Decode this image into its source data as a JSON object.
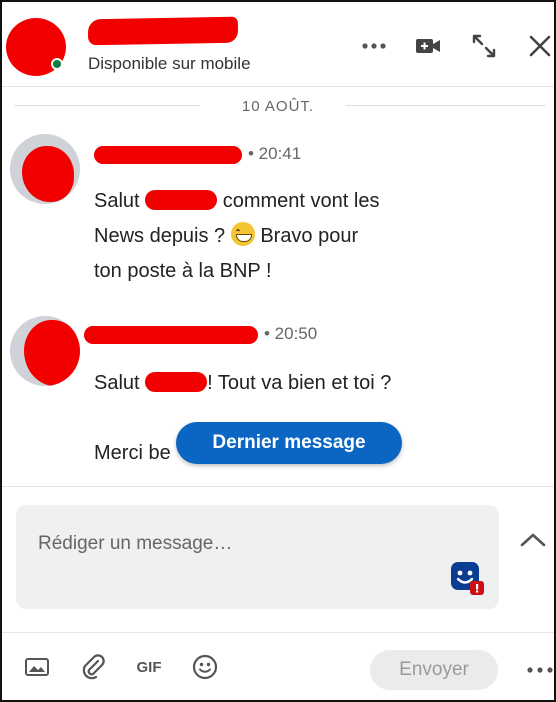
{
  "header": {
    "status": "Disponible sur mobile",
    "icons": [
      "more-icon",
      "video-call-icon",
      "minimize-icon",
      "close-icon"
    ]
  },
  "conversation": {
    "date_separator": "10 AOÛT.",
    "messages": [
      {
        "time": "• 20:41",
        "line1_before": "Salut",
        "line1_after": "comment vont les",
        "line2_before": "News depuis ?",
        "line2_after": "Bravo pour",
        "line3": "ton poste à la BNP !"
      },
      {
        "time": "• 20:50",
        "line1_before": "Salut",
        "line1_after": "! Tout va bien et toi ?",
        "line2": "Merci be"
      }
    ],
    "jump_label": "Dernier message"
  },
  "composer": {
    "placeholder": "Rédiger un message…",
    "send_label": "Envoyer",
    "gif_label": "GIF"
  },
  "colors": {
    "accent": "#0a66c2",
    "redaction": "#f20000",
    "online": "#107e3e"
  }
}
